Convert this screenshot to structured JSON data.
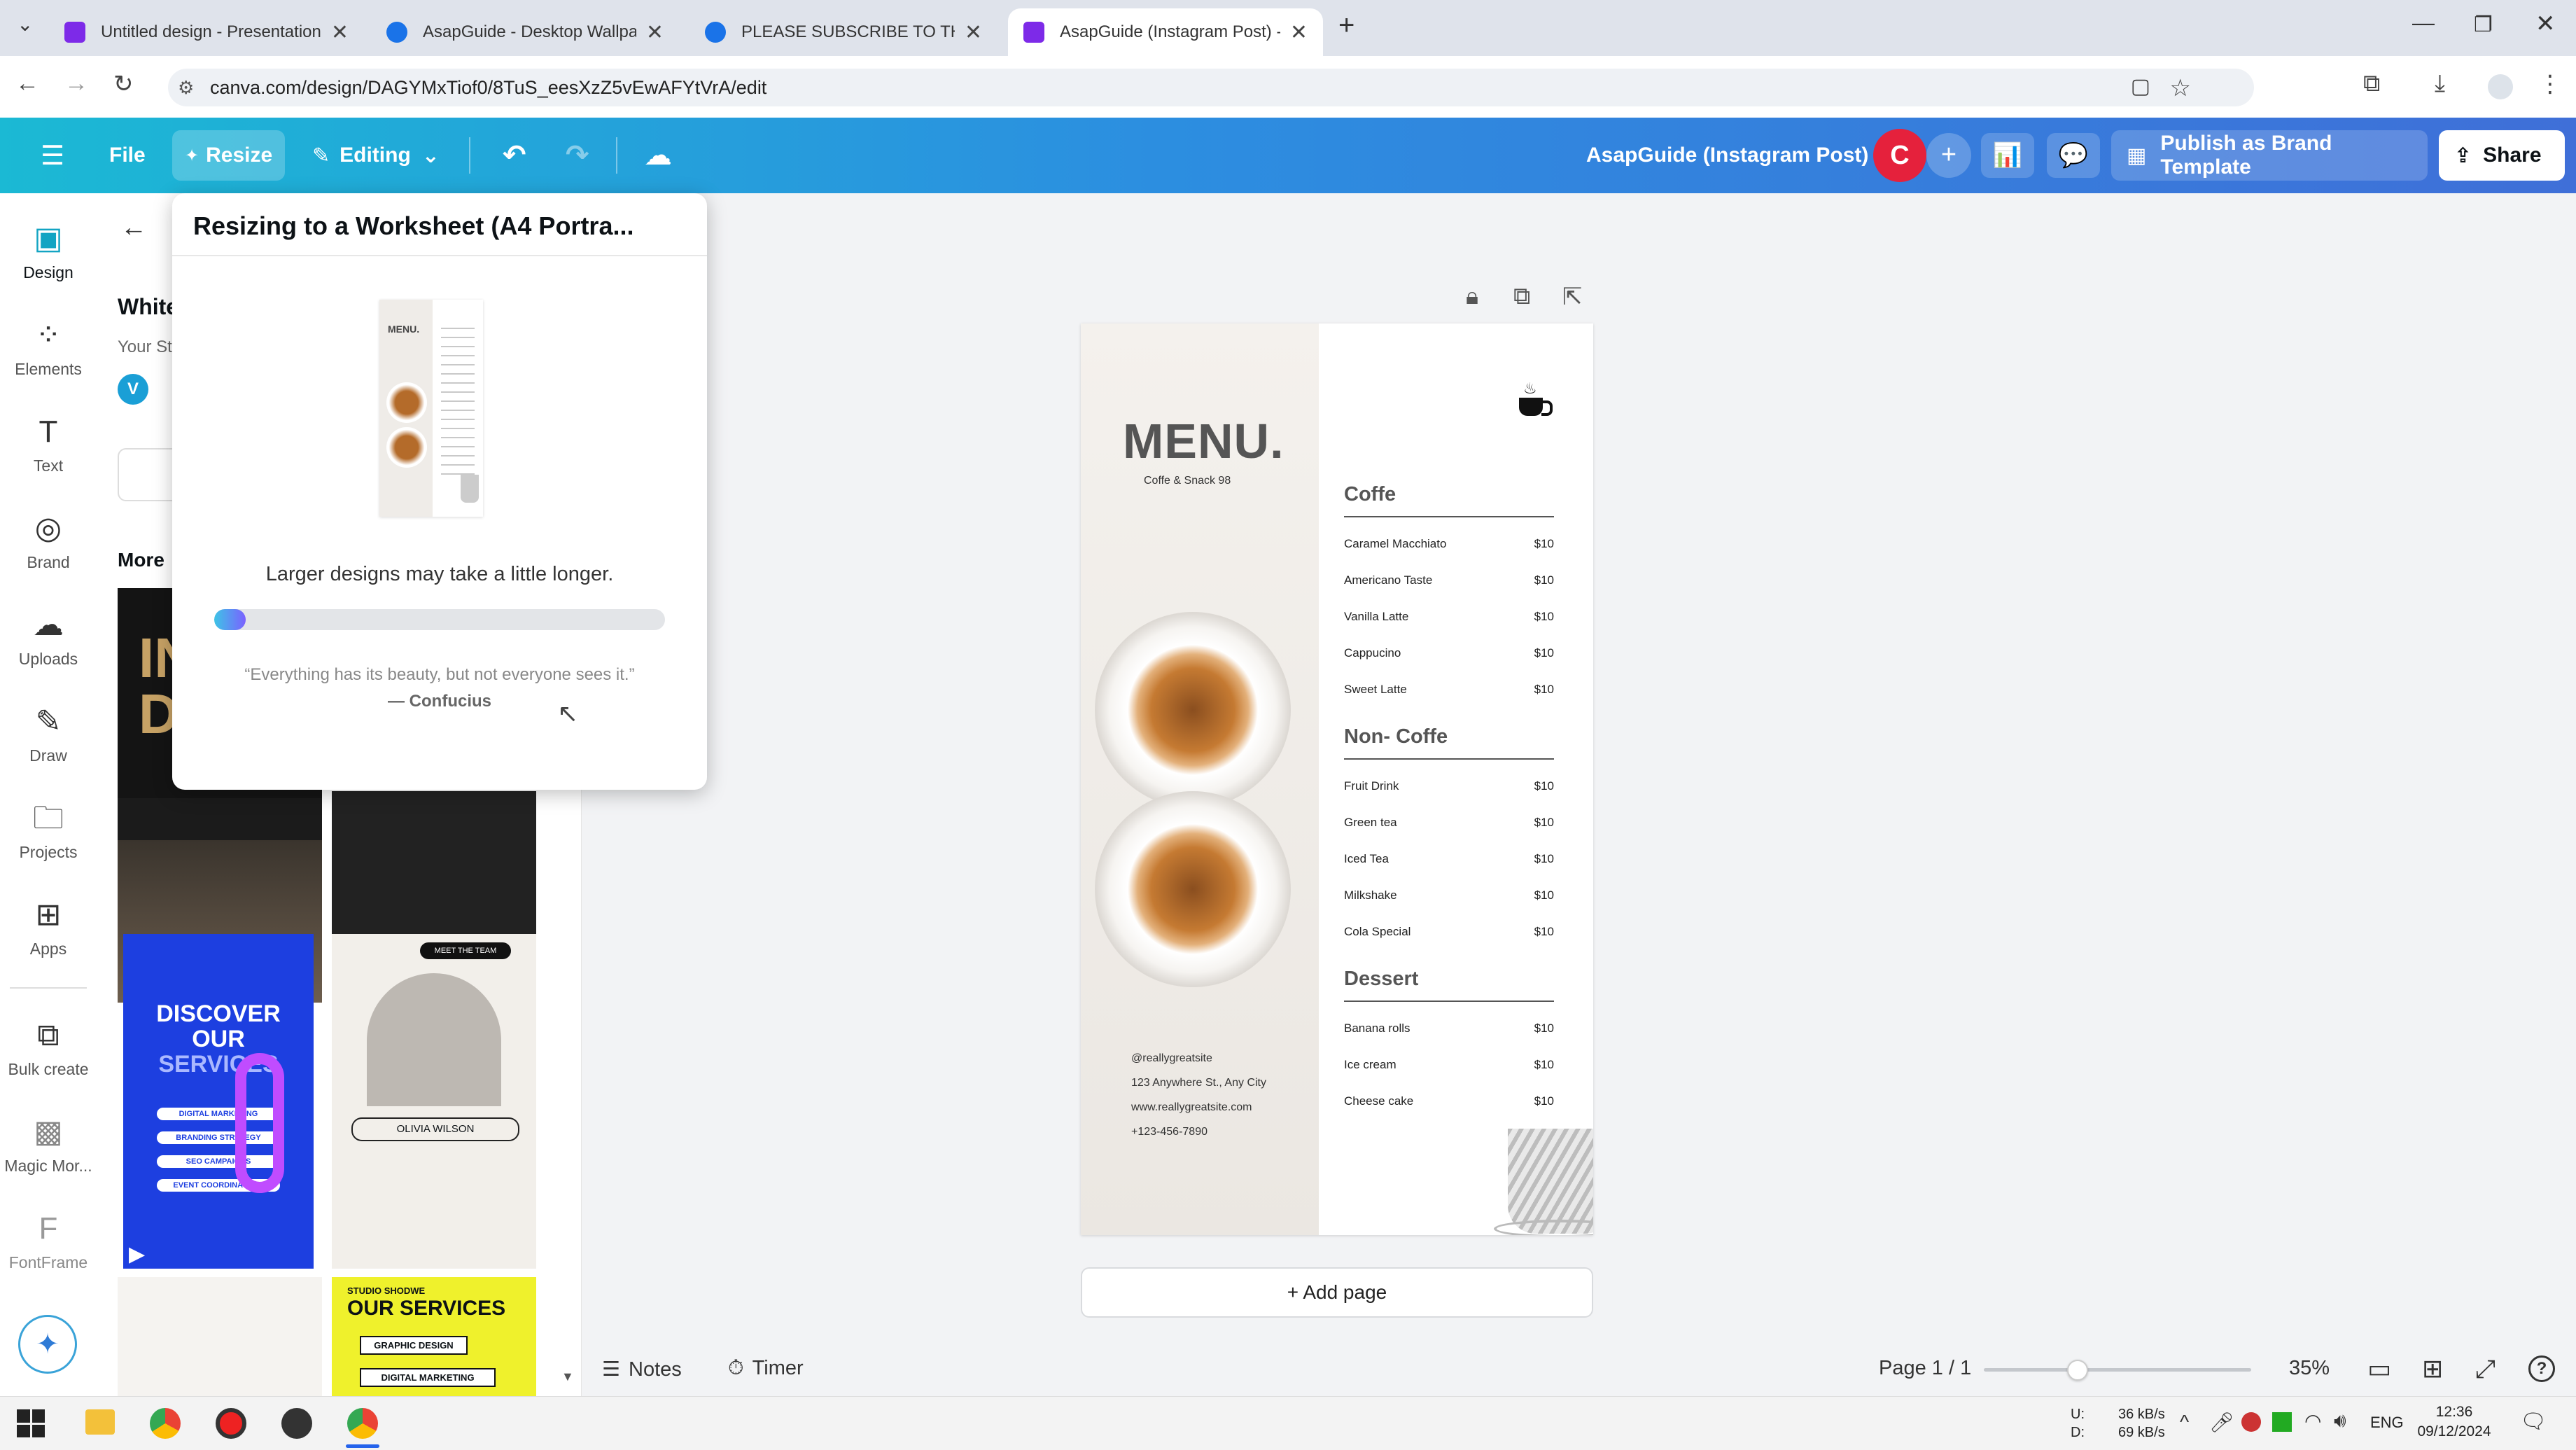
{
  "browser": {
    "tabs": [
      {
        "title": "Untitled design - Presentation"
      },
      {
        "title": "AsapGuide - Desktop Wallpape"
      },
      {
        "title": "PLEASE SUBSCRIBE TO THIS CH"
      },
      {
        "title": "AsapGuide (Instagram Post) - Y"
      }
    ],
    "new_tab": "+",
    "url": "canva.com/design/DAGYMxTiof0/8TuS_eesXzZ5vEwAFYtVrA/edit"
  },
  "header": {
    "file": "File",
    "resize": "Resize",
    "editing": "Editing",
    "doc_title": "AsapGuide (Instagram Post)",
    "avatar_letter": "C",
    "publish": "Publish as Brand Template",
    "share": "Share"
  },
  "rail": [
    {
      "label": "Design"
    },
    {
      "label": "Elements"
    },
    {
      "label": "Text"
    },
    {
      "label": "Brand"
    },
    {
      "label": "Uploads"
    },
    {
      "label": "Draw"
    },
    {
      "label": "Projects"
    },
    {
      "label": "Apps"
    },
    {
      "label": "Bulk create"
    },
    {
      "label": "Magic Mor..."
    },
    {
      "label": "FontFrame"
    }
  ],
  "panel": {
    "title": "White",
    "subtitle": "Your St",
    "avatar": "V",
    "more": "More",
    "thumbs": {
      "discover": "DISCOVER",
      "our": "OUR",
      "services": "SERVICES",
      "olivia": "OLIVIA WILSON",
      "meet": "MEET THE TEAM",
      "our_services": "OUR SERVICES",
      "studio": "STUDIO SHODWE",
      "graphic": "GRAPHIC DESIGN",
      "digital": "DIGITAL MARKETING",
      "pill1": "DIGITAL MARKETING",
      "pill2": "BRANDING STRATEGY",
      "pill3": "SEO CAMPAIGNS",
      "pill4": "EVENT COORDINATORS"
    }
  },
  "popup": {
    "title": "Resizing to a Worksheet (A4 Portra...",
    "note": "Larger designs may take a little longer.",
    "progress": 0.07,
    "quote": "“Everything has its beauty, but not everyone sees it.”",
    "author": "— Confucius",
    "thumb_menu": "MENU."
  },
  "menu": {
    "title": "MENU.",
    "subtitle": "Coffe & Snack 98",
    "sections": [
      {
        "name": "Coffe",
        "items": [
          {
            "item": "Caramel Macchiato",
            "price": "$10"
          },
          {
            "item": "Americano Taste",
            "price": "$10"
          },
          {
            "item": "Vanilla Latte",
            "price": "$10"
          },
          {
            "item": "Cappucino",
            "price": "$10"
          },
          {
            "item": "Sweet Latte",
            "price": "$10"
          }
        ]
      },
      {
        "name": "Non- Coffe",
        "items": [
          {
            "item": "Fruit Drink",
            "price": "$10"
          },
          {
            "item": "Green tea",
            "price": "$10"
          },
          {
            "item": "Iced Tea",
            "price": "$10"
          },
          {
            "item": "Milkshake",
            "price": "$10"
          },
          {
            "item": "Cola Special",
            "price": "$10"
          }
        ]
      },
      {
        "name": "Dessert",
        "items": [
          {
            "item": "Banana rolls",
            "price": "$10"
          },
          {
            "item": "Ice cream",
            "price": "$10"
          },
          {
            "item": "Cheese cake",
            "price": "$10"
          }
        ]
      }
    ],
    "contact": [
      "@reallygreatsite",
      "123 Anywhere St., Any City",
      "www.reallygreatsite.com",
      "+123-456-7890"
    ]
  },
  "canvas": {
    "add_page": "+ Add page"
  },
  "bottom": {
    "notes": "Notes",
    "timer": "Timer",
    "page": "Page 1 / 1",
    "zoom": "35%",
    "zoom_level": 0.35
  },
  "taskbar": {
    "net_up": "36 kB/s",
    "net_down": "69 kB/s",
    "u": "U:",
    "d": "D:",
    "lang": "ENG",
    "time": "12:36",
    "date": "09/12/2024"
  },
  "colors": {
    "header_start": "#1bb9d4",
    "header_end": "#3f6fd8",
    "avatar": "#e5213c",
    "progress_start": "#3dc4e6",
    "progress_end": "#7b61ff"
  }
}
